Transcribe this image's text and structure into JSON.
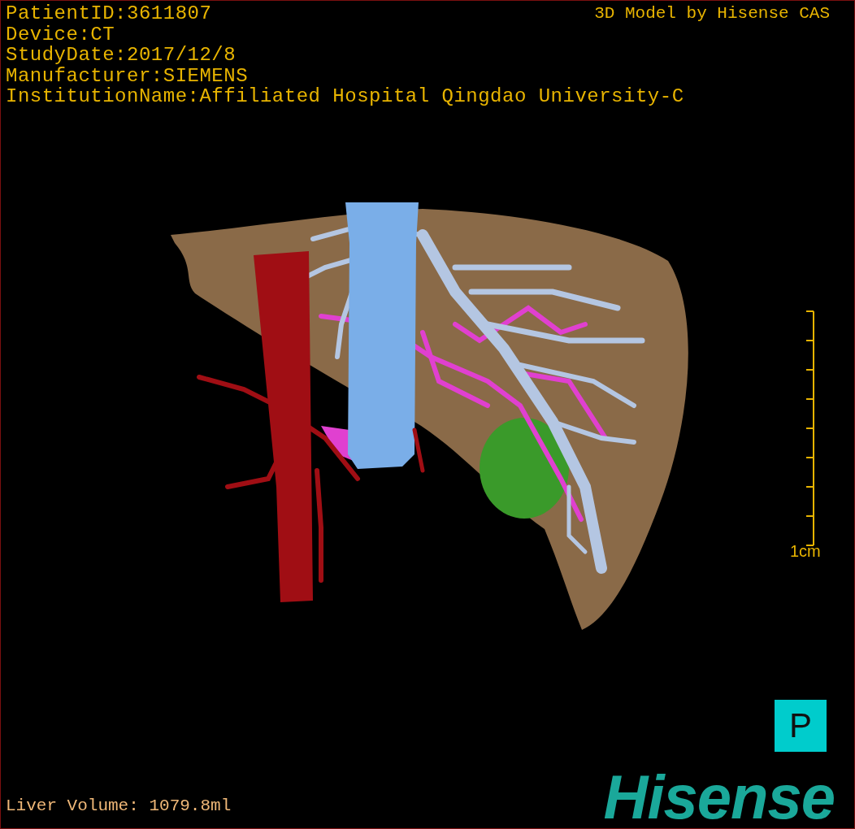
{
  "patient_info": [
    "PatientID:3611807",
    "Device:CT",
    "StudyDate:2017/12/8",
    "Manufacturer:SIEMENS",
    "InstitutionName:Affiliated Hospital Qingdao University-C"
  ],
  "title": "3D Model by Hisense CAS",
  "scale": {
    "label": "1cm"
  },
  "orientation_marker": "P",
  "liver_volume": "Liver Volume: 1079.8ml",
  "logo": "Hisense"
}
